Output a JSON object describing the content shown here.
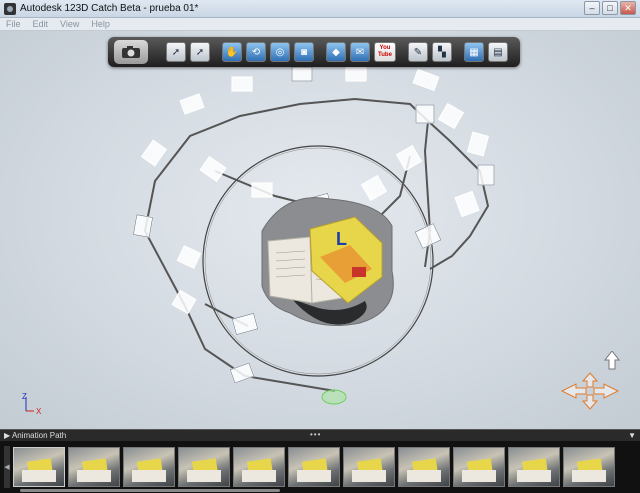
{
  "window": {
    "title": "Autodesk 123D Catch Beta - prueba 01*",
    "controls": {
      "minimize": "–",
      "maximize": "□",
      "close": "✕"
    }
  },
  "menu": {
    "items": [
      "File",
      "Edit",
      "View",
      "Help"
    ]
  },
  "toolbar": {
    "icons": [
      "camera-icon",
      "select-arrow-icon",
      "select-add-icon",
      "pan-hand-icon",
      "orbit-icon",
      "zoom-icon",
      "recapture-camera-icon",
      "material-icon",
      "email-icon",
      "youtube-icon",
      "tool-icon",
      "path-icon",
      "cube-export-icon",
      "document-icon"
    ],
    "youtube_label_top": "You",
    "youtube_label_bottom": "Tube"
  },
  "viewport": {
    "axis": {
      "z_label": "Z",
      "x_label": "X"
    },
    "book_label": "L"
  },
  "animation_path": {
    "label": "Animation Path",
    "dots": "•••",
    "dropdown": "▼",
    "thumbnail_count": 11
  },
  "colors": {
    "viewport_bg": "#d3dae1",
    "toolbar_bg": "#1e1e1e",
    "book_yellow": "#e8d64a",
    "path_line": "#555555",
    "axis_x": "#d21e1e",
    "axis_z": "#2030c0"
  }
}
